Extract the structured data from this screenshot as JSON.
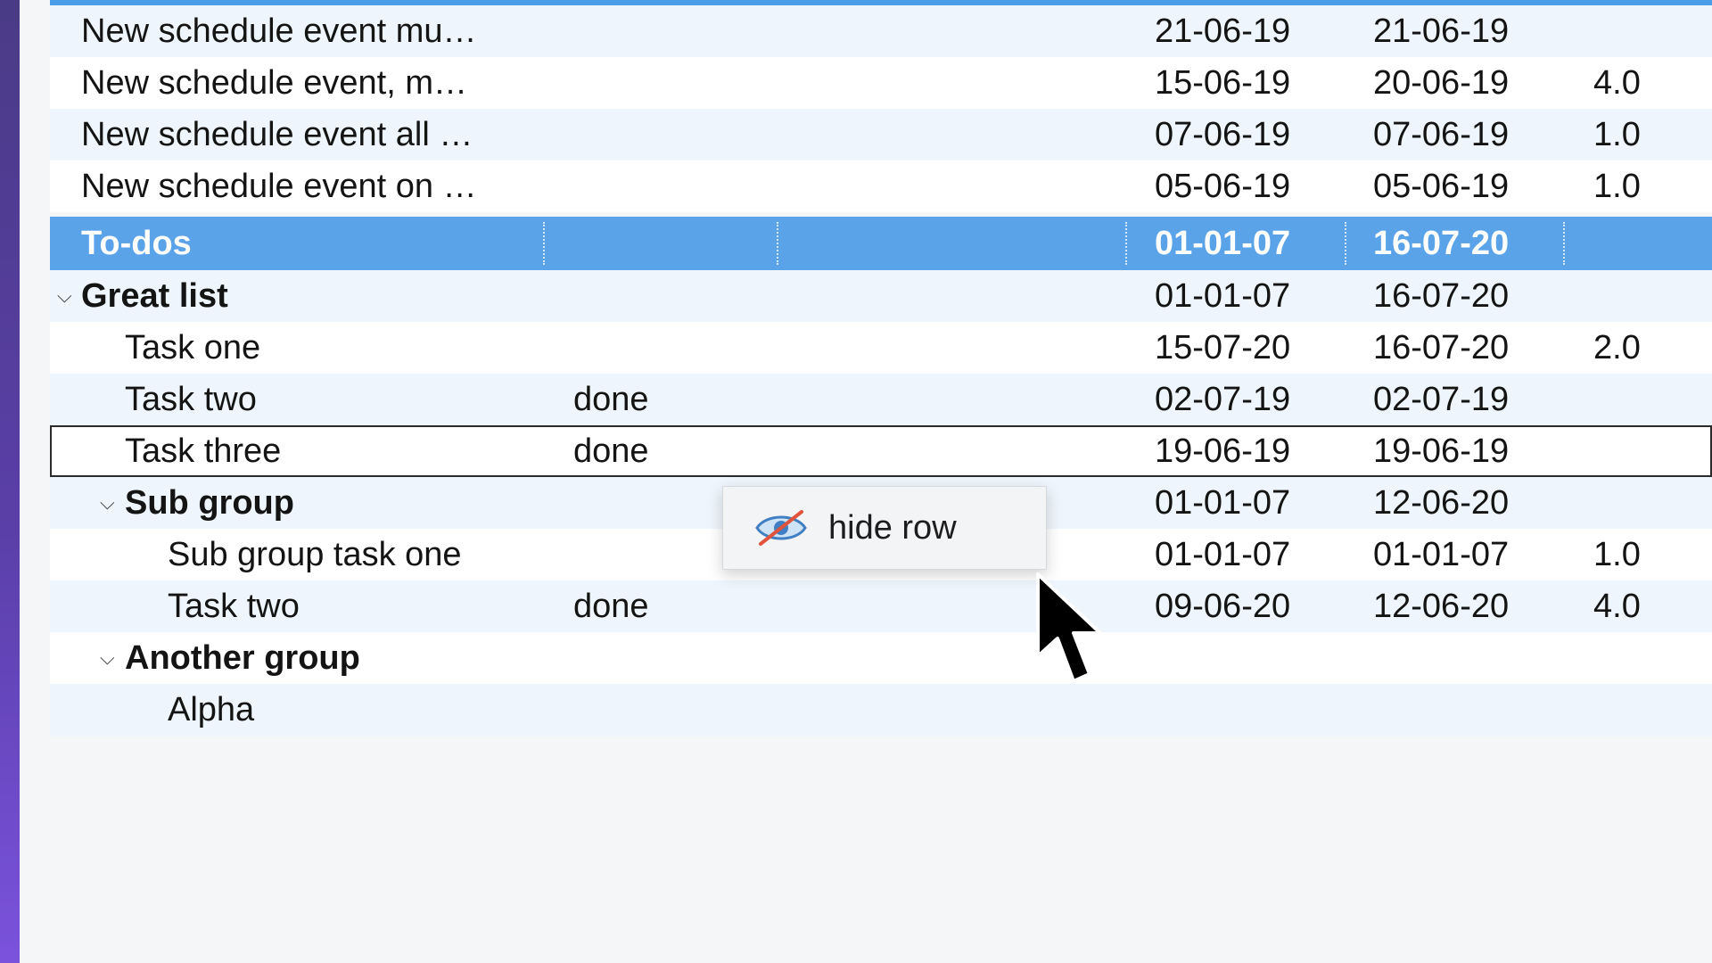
{
  "rows_top": [
    {
      "name": "New schedule event mu…",
      "start": "21-06-19",
      "end": "21-06-19",
      "duration": ""
    },
    {
      "name": "New schedule event, m…",
      "start": "15-06-19",
      "end": "20-06-19",
      "duration": "4.0"
    },
    {
      "name": "New schedule event all …",
      "start": "07-06-19",
      "end": "07-06-19",
      "duration": "1.0"
    },
    {
      "name": "New schedule event on …",
      "start": "05-06-19",
      "end": "05-06-19",
      "duration": "1.0"
    }
  ],
  "section": {
    "name": "To-dos",
    "start": "01-01-07",
    "end": "16-07-20"
  },
  "great_list": {
    "name": "Great list",
    "start": "01-01-07",
    "end": "16-07-20"
  },
  "tasks": [
    {
      "name": "Task one",
      "status": "",
      "start": "15-07-20",
      "end": "16-07-20",
      "duration": "2.0"
    },
    {
      "name": "Task two",
      "status": "done",
      "start": "02-07-19",
      "end": "02-07-19",
      "duration": ""
    },
    {
      "name": "Task three",
      "status": "done",
      "start": "19-06-19",
      "end": "19-06-19",
      "duration": ""
    }
  ],
  "sub_group": {
    "name": "Sub group",
    "start": "01-01-07",
    "end": "12-06-20"
  },
  "sub_tasks": [
    {
      "name": "Sub group task one",
      "status": "",
      "start": "01-01-07",
      "end": "01-01-07",
      "duration": "1.0"
    },
    {
      "name": "Task two",
      "status": "done",
      "start": "09-06-20",
      "end": "12-06-20",
      "duration": "4.0"
    }
  ],
  "another_group": {
    "name": "Another group"
  },
  "another_tasks": [
    {
      "name": "Alpha"
    }
  ],
  "context_menu": {
    "label": "hide row",
    "icon": "hidden-eye-icon"
  },
  "colors": {
    "header_blue": "#5ba3e8",
    "alt_row": "#eef5fc",
    "accent_purple": "#5a3fa8"
  }
}
